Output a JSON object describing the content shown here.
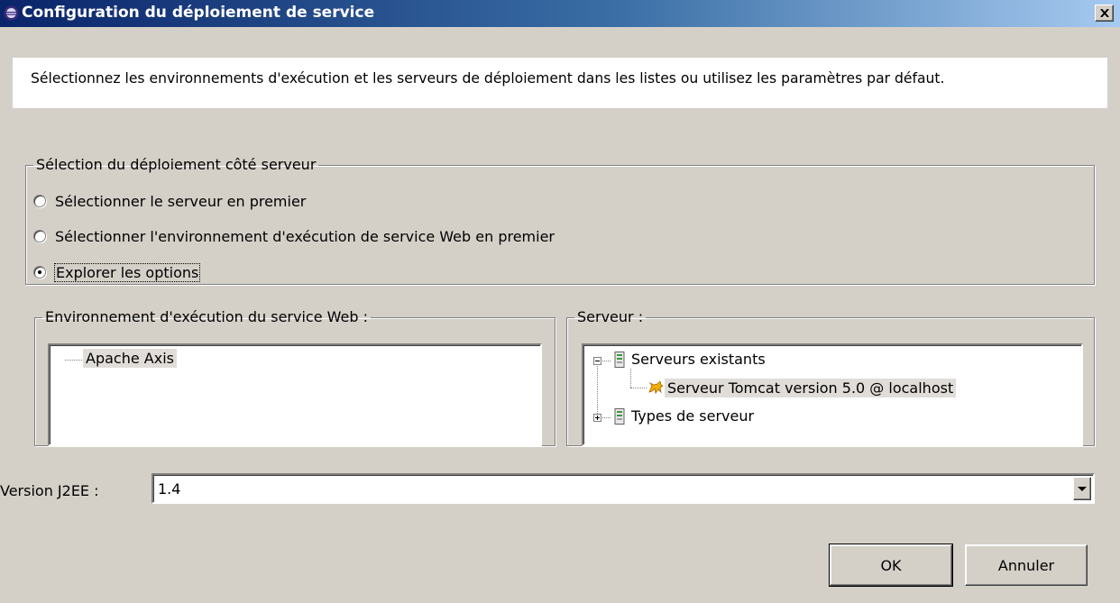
{
  "window": {
    "title": "Configuration du déploiement de service",
    "close_icon": "close-icon"
  },
  "description": "Sélectionnez les environnements d'exécution et les serveurs de déploiement dans les listes ou utilisez les paramètres par défaut.",
  "deployment_selection": {
    "legend": "Sélection du déploiement côté serveur",
    "options": [
      {
        "label": "Sélectionner le serveur en premier",
        "checked": false
      },
      {
        "label": "Sélectionner l'environnement d'exécution de service Web en premier",
        "checked": false
      },
      {
        "label": "Explorer les options",
        "checked": true
      }
    ]
  },
  "runtime_group": {
    "legend": "Environnement d'exécution du service Web :",
    "items": [
      "Apache Axis"
    ]
  },
  "server_group": {
    "legend": "Serveur :",
    "tree": [
      {
        "label": "Serveurs existants",
        "expanded": true,
        "icon": "server-icon",
        "children": [
          {
            "label": "Serveur Tomcat version 5.0 @ localhost",
            "icon": "tomcat-icon",
            "selected": true
          }
        ]
      },
      {
        "label": "Types de serveur",
        "expanded": false,
        "icon": "server-icon"
      }
    ]
  },
  "j2ee": {
    "label": "Version J2EE :",
    "value": "1.4"
  },
  "buttons": {
    "ok": "OK",
    "cancel": "Annuler"
  }
}
